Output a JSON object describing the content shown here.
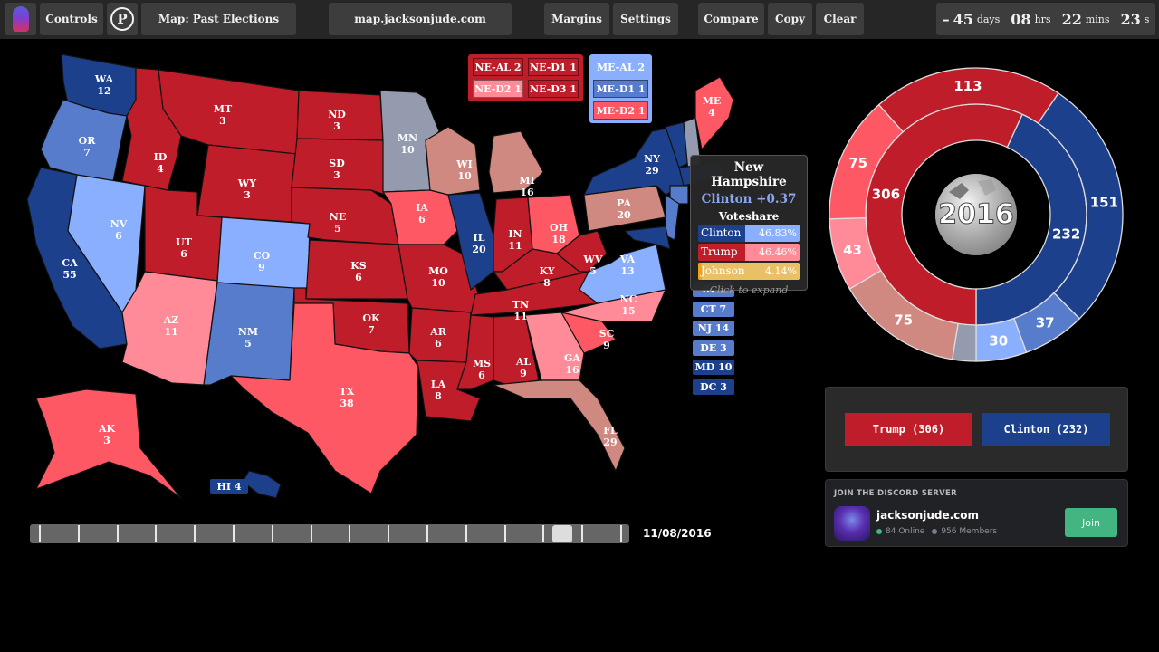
{
  "topbar": {
    "logo": "ghost-logo",
    "controls": "Controls",
    "p_button": "P",
    "map_select": "Map: Past Elections",
    "site_link": "map.jacksonjude.com",
    "margins": "Margins",
    "settings": "Settings",
    "compare": "Compare",
    "copy": "Copy",
    "clear": "Clear",
    "countdown": {
      "prefix": "–",
      "days": "45",
      "days_unit": "days",
      "hrs": "08",
      "hrs_unit": "hrs",
      "mins": "22",
      "mins_unit": "mins",
      "secs": "23",
      "secs_unit": "s"
    }
  },
  "colors": {
    "dem_safe": "#1c408c",
    "dem_likely": "#587ccc",
    "dem_lean": "#8aafff",
    "dem_tilt": "#949baf",
    "rep_safe": "#bf1d29",
    "rep_likely": "#ff5865",
    "rep_lean": "#ff8b98",
    "rep_tilt": "#cf8980",
    "tossup": "#949baf",
    "third": "#eac066"
  },
  "states": [
    {
      "abbr": "WA",
      "ev": "12",
      "cat": "dem_safe"
    },
    {
      "abbr": "OR",
      "ev": "7",
      "cat": "dem_likely"
    },
    {
      "abbr": "CA",
      "ev": "55",
      "cat": "dem_safe"
    },
    {
      "abbr": "NV",
      "ev": "6",
      "cat": "dem_lean"
    },
    {
      "abbr": "ID",
      "ev": "4",
      "cat": "rep_safe"
    },
    {
      "abbr": "MT",
      "ev": "3",
      "cat": "rep_safe"
    },
    {
      "abbr": "WY",
      "ev": "3",
      "cat": "rep_safe"
    },
    {
      "abbr": "UT",
      "ev": "6",
      "cat": "rep_safe"
    },
    {
      "abbr": "AZ",
      "ev": "11",
      "cat": "rep_lean"
    },
    {
      "abbr": "CO",
      "ev": "9",
      "cat": "dem_lean"
    },
    {
      "abbr": "NM",
      "ev": "5",
      "cat": "dem_likely"
    },
    {
      "abbr": "ND",
      "ev": "3",
      "cat": "rep_safe"
    },
    {
      "abbr": "SD",
      "ev": "3",
      "cat": "rep_safe"
    },
    {
      "abbr": "NE",
      "ev": "5",
      "cat": "rep_safe"
    },
    {
      "abbr": "KS",
      "ev": "6",
      "cat": "rep_safe"
    },
    {
      "abbr": "OK",
      "ev": "7",
      "cat": "rep_safe"
    },
    {
      "abbr": "TX",
      "ev": "38",
      "cat": "rep_likely"
    },
    {
      "abbr": "MN",
      "ev": "10",
      "cat": "tossup"
    },
    {
      "abbr": "IA",
      "ev": "6",
      "cat": "rep_likely"
    },
    {
      "abbr": "MO",
      "ev": "10",
      "cat": "rep_safe"
    },
    {
      "abbr": "AR",
      "ev": "6",
      "cat": "rep_safe"
    },
    {
      "abbr": "LA",
      "ev": "8",
      "cat": "rep_safe"
    },
    {
      "abbr": "WI",
      "ev": "10",
      "cat": "rep_tilt"
    },
    {
      "abbr": "IL",
      "ev": "20",
      "cat": "dem_safe"
    },
    {
      "abbr": "MI",
      "ev": "16",
      "cat": "rep_tilt"
    },
    {
      "abbr": "IN",
      "ev": "11",
      "cat": "rep_safe"
    },
    {
      "abbr": "OH",
      "ev": "18",
      "cat": "rep_likely"
    },
    {
      "abbr": "KY",
      "ev": "8",
      "cat": "rep_safe"
    },
    {
      "abbr": "TN",
      "ev": "11",
      "cat": "rep_safe"
    },
    {
      "abbr": "MS",
      "ev": "6",
      "cat": "rep_safe"
    },
    {
      "abbr": "AL",
      "ev": "9",
      "cat": "rep_safe"
    },
    {
      "abbr": "GA",
      "ev": "16",
      "cat": "rep_lean"
    },
    {
      "abbr": "FL",
      "ev": "29",
      "cat": "rep_tilt"
    },
    {
      "abbr": "SC",
      "ev": "9",
      "cat": "rep_likely"
    },
    {
      "abbr": "NC",
      "ev": "15",
      "cat": "rep_lean"
    },
    {
      "abbr": "VA",
      "ev": "13",
      "cat": "dem_lean"
    },
    {
      "abbr": "WV",
      "ev": "5",
      "cat": "rep_safe"
    },
    {
      "abbr": "PA",
      "ev": "20",
      "cat": "rep_tilt"
    },
    {
      "abbr": "NY",
      "ev": "29",
      "cat": "dem_safe"
    },
    {
      "abbr": "ME",
      "ev": "4",
      "cat": "rep_likely"
    },
    {
      "abbr": "AK",
      "ev": "3",
      "cat": "rep_likely"
    },
    {
      "abbr": "HI",
      "ev": "4",
      "cat": "dem_safe"
    }
  ],
  "districts": {
    "nebraska": [
      {
        "label": "NE-AL 2",
        "cat": "rep_safe"
      },
      {
        "label": "NE-D1 1",
        "cat": "rep_safe"
      },
      {
        "label": "NE-D2 1",
        "cat": "rep_lean"
      },
      {
        "label": "NE-D3 1",
        "cat": "rep_safe"
      }
    ],
    "maine": [
      {
        "label": "ME-AL 2",
        "cat": "dem_lean"
      },
      {
        "label": "ME-D1 1",
        "cat": "dem_likely"
      },
      {
        "label": "ME-D2 1",
        "cat": "rep_likely"
      }
    ]
  },
  "small_states": [
    {
      "label": "RI 4",
      "cat": "dem_likely"
    },
    {
      "label": "CT 7",
      "cat": "dem_likely"
    },
    {
      "label": "NJ 14",
      "cat": "dem_likely"
    },
    {
      "label": "DE 3",
      "cat": "dem_likely"
    },
    {
      "label": "MD 10",
      "cat": "dem_safe"
    },
    {
      "label": "DC 3",
      "cat": "dem_safe"
    }
  ],
  "hawaii_label": "HI 4",
  "tooltip": {
    "state": "New Hampshire",
    "margin": "Clinton +0.37",
    "voteshare_label": "Voteshare",
    "rows": [
      {
        "name": "Clinton",
        "pct": "46.83%",
        "fill": 0.4683
      },
      {
        "name": "Trump",
        "pct": "46.46%",
        "fill": 0.4646
      },
      {
        "name": "Johnson",
        "pct": "4.14%",
        "fill": 0.0414
      }
    ],
    "footer": "Click to expand"
  },
  "chart_data": {
    "type": "pie",
    "title": "2016",
    "center_label": "2016",
    "inner_ring": {
      "categories": [
        "Clinton",
        "Trump"
      ],
      "values": [
        232,
        306
      ],
      "labels": [
        "232",
        "306"
      ]
    },
    "outer_ring": {
      "categories": [
        "Dem Safe",
        "Dem Likely",
        "Dem Lean",
        "Tossup",
        "Rep Tilt",
        "Rep Lean",
        "Rep Likely",
        "Rep Safe"
      ],
      "values": [
        151,
        37,
        30,
        14,
        75,
        43,
        75,
        113
      ],
      "labels": [
        "151",
        "37",
        "30",
        "",
        "75",
        "43",
        "75",
        "113"
      ]
    }
  },
  "candidates": {
    "trump_label": "Trump (306)",
    "clinton_label": "Clinton (232)"
  },
  "discord": {
    "header": "JOIN THE DISCORD SERVER",
    "server": "jacksonjude.com",
    "online": "84 Online",
    "members": "956 Members",
    "join": "Join"
  },
  "timeline": {
    "date": "11/08/2016",
    "tick_count": 16,
    "position": 0.9
  }
}
